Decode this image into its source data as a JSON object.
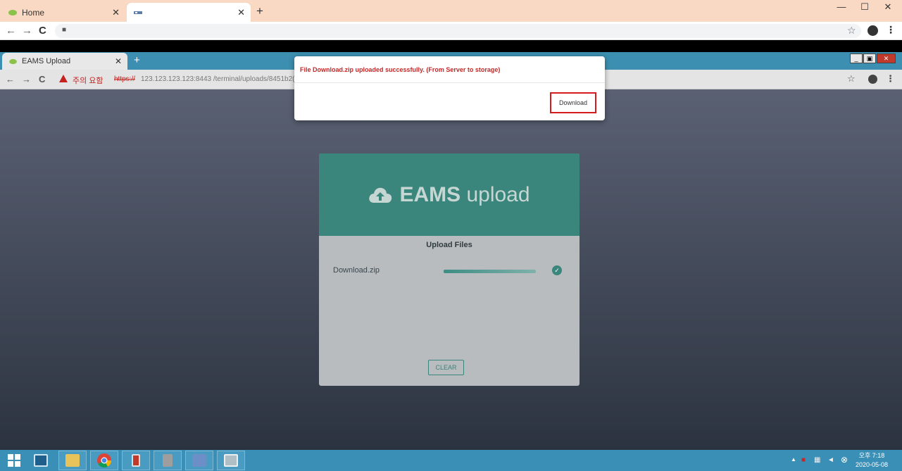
{
  "outer_browser": {
    "tabs": [
      {
        "label": "Home",
        "close": "✕"
      },
      {
        "label": "",
        "close": "✕"
      }
    ],
    "new_tab": "+",
    "window_controls": {
      "minimize": "—",
      "maximize": "☐",
      "close": "✕"
    },
    "nav": {
      "back": "←",
      "forward": "→",
      "reload": "C"
    }
  },
  "inner_browser": {
    "tab": {
      "label": "EAMS Upload",
      "close": "✕"
    },
    "new_tab": "+",
    "window_controls": {
      "minimize": "_",
      "restore": "▣",
      "close": "✕"
    },
    "nav": {
      "back": "←",
      "forward": "→",
      "reload": "C"
    },
    "warning": "주의 요함",
    "scheme": "https://",
    "url": "123.123.123.123:8443 /terminal/uploads/8451b2(",
    "menu": "⋮"
  },
  "upload_panel": {
    "title_bold": "EAMS",
    "title_light": " upload",
    "section_title": "Upload Files",
    "file": {
      "name": "Download.zip",
      "progress": 1.0
    },
    "clear_label": "CLEAR"
  },
  "modal": {
    "message": "File Download.zip uploaded successfully. (From Server to storage)",
    "download_label": "Download"
  },
  "taskbar": {
    "clock_time": "오후 7:18",
    "clock_date": "2020-05-08"
  },
  "colors": {
    "accent_teal": "#3a857c",
    "error_red": "#c52626",
    "highlight_red": "#d71920",
    "taskbar_blue": "#3a8fb7"
  }
}
